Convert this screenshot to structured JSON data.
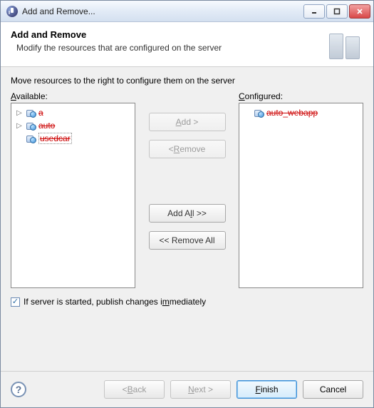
{
  "window": {
    "title": "Add and Remove..."
  },
  "banner": {
    "heading": "Add and Remove",
    "sub": "Modify the resources that are configured on the server"
  },
  "instruction": "Move resources to the right to configure them on the server",
  "available": {
    "label_pre": "A",
    "label_post": "vailable:",
    "items": [
      {
        "text": "a",
        "expandable": true,
        "selected": false
      },
      {
        "text": "auto",
        "expandable": true,
        "selected": false
      },
      {
        "text": "usedcar",
        "expandable": false,
        "selected": true
      }
    ]
  },
  "configured": {
    "label_pre": "C",
    "label_post": "onfigured:",
    "items": [
      {
        "text": "auto_webapp",
        "expandable": false,
        "selected": false
      }
    ]
  },
  "buttons": {
    "add_pre": "A",
    "add_post": "dd >",
    "remove_pre": "< ",
    "remove_u": "R",
    "remove_post": "emove",
    "add_all_pre": "Add A",
    "add_all_u": "l",
    "add_all_post": "l >>",
    "remove_all": "<< Remove All"
  },
  "checkbox": {
    "checked": true,
    "label_pre": "If server is started, publish changes i",
    "label_u": "m",
    "label_post": "mediately"
  },
  "footer": {
    "back_pre": "< ",
    "back_u": "B",
    "back_post": "ack",
    "next_u": "N",
    "next_post": "ext >",
    "finish_u": "F",
    "finish_post": "inish",
    "cancel": "Cancel"
  }
}
